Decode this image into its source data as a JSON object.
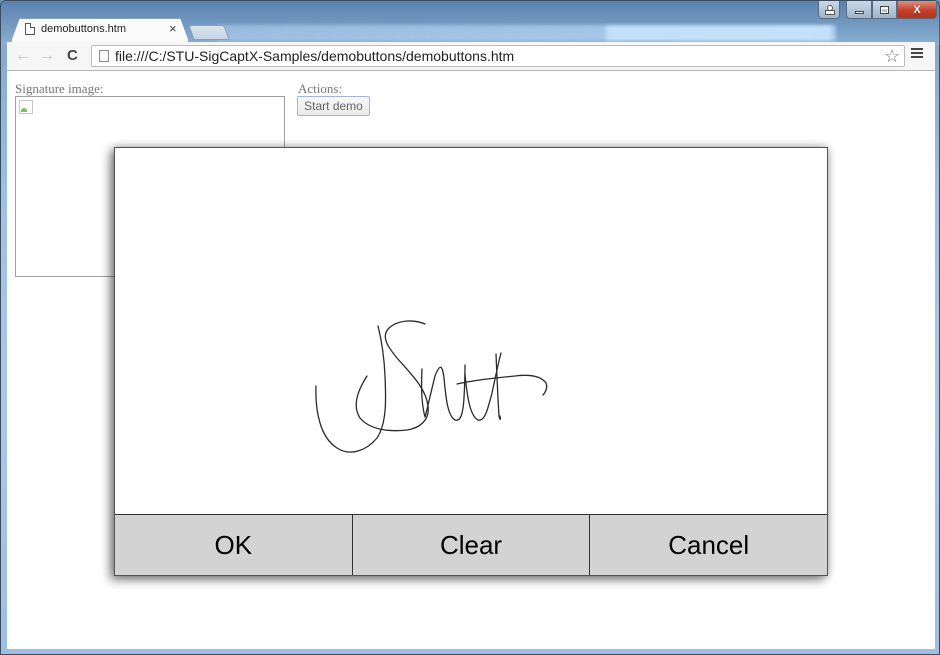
{
  "browser": {
    "tabs": [
      {
        "title": "demobuttons.htm",
        "active": true
      }
    ],
    "address": "file:///C:/STU-SigCaptX-Samples/demobuttons/demobuttons.htm",
    "icons": {
      "back": "arrow-left-icon",
      "forward": "arrow-right-icon",
      "reload": "reload-icon",
      "bookmark": "star-icon",
      "menu": "hamburger-menu-icon",
      "tab_close": "close-icon"
    },
    "glyphs": {
      "back": "←",
      "forward": "→",
      "reload": "C",
      "bookmark": "☆",
      "tab_close": "×",
      "window_close": "X"
    }
  },
  "page": {
    "signature_label": "Signature image:",
    "actions_label": "Actions:",
    "start_demo_label": "Start demo"
  },
  "signature_pad": {
    "buttons": [
      {
        "label": "OK"
      },
      {
        "label": "Clear"
      },
      {
        "label": "Cancel"
      }
    ],
    "button_color": "#d3d3d3",
    "ink_color": "#2a2a2a"
  }
}
